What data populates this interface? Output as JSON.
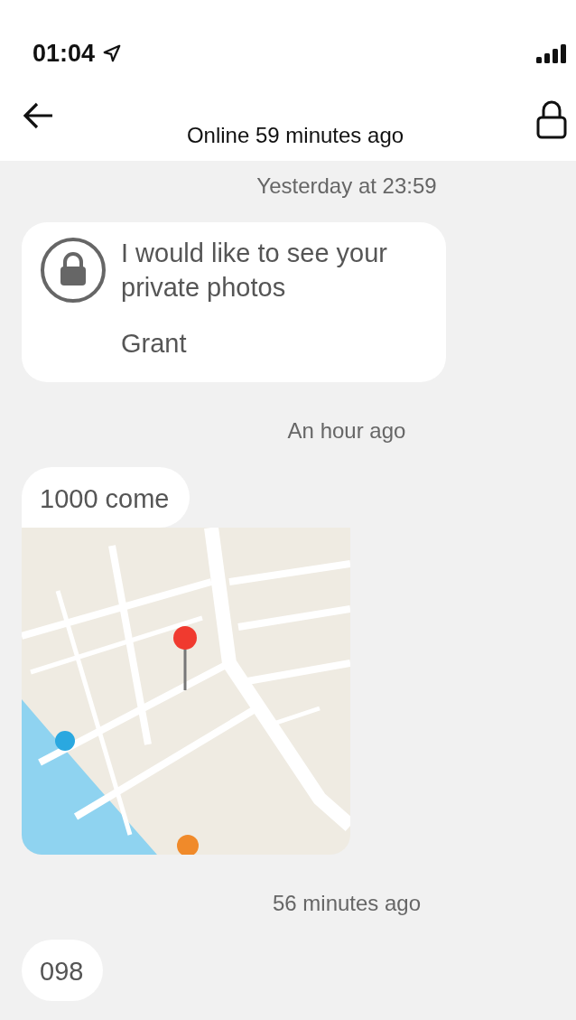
{
  "status_bar": {
    "time": "01:04"
  },
  "header": {
    "subtitle": "Online 59 minutes ago"
  },
  "messages": [
    {
      "kind": "timestamp",
      "text": "Yesterday at 23:59"
    },
    {
      "kind": "request",
      "text": "I would like to see your private photos",
      "sender": "Grant"
    },
    {
      "kind": "timestamp",
      "text": "An hour ago"
    },
    {
      "kind": "text",
      "text": "1000 come"
    },
    {
      "kind": "location"
    },
    {
      "kind": "timestamp",
      "text": "56 minutes ago"
    },
    {
      "kind": "text",
      "text": "098"
    }
  ]
}
